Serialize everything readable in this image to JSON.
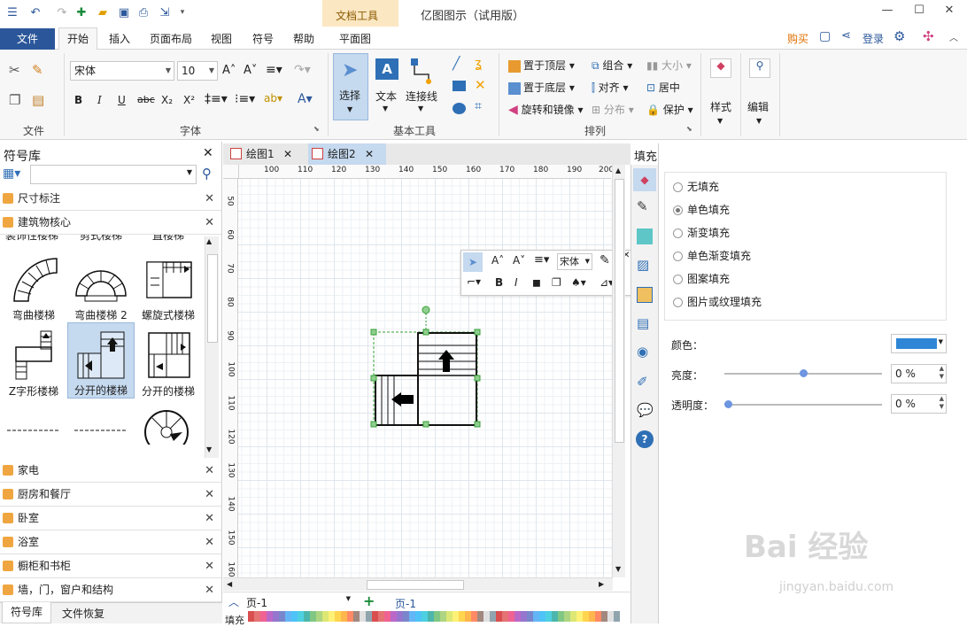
{
  "title_bar": {
    "app_title": "亿图图示（试用版）",
    "context_group": "文档工具"
  },
  "tabs": {
    "file": "文件",
    "home": "开始",
    "insert": "插入",
    "page_layout": "页面布局",
    "view": "视图",
    "symbol": "符号",
    "help": "帮助",
    "floor_plan": "平面图",
    "buy": "购买",
    "login": "登录"
  },
  "ribbon": {
    "file_group": "文件",
    "font_group": "字体",
    "basic_tools_group": "基本工具",
    "arrange_group": "排列",
    "font_name": "宋体",
    "font_size": "10",
    "select": "选择",
    "text": "文本",
    "connector": "连接线",
    "bring_to_front": "置于顶层",
    "send_to_back": "置于底层",
    "rotate_mirror": "旋转和镜像",
    "group": "组合",
    "align": "对齐",
    "distribute": "分布",
    "size": "大小",
    "center": "居中",
    "protect": "保护",
    "style": "样式",
    "edit": "编辑"
  },
  "library": {
    "title": "符号库",
    "search_placeholder": "",
    "open_categories": [
      "尺寸标注",
      "建筑物核心"
    ],
    "partial_labels": [
      "装饰性楼梯",
      "剪式楼梯",
      "直楼梯"
    ],
    "symbols": [
      {
        "label": "弯曲楼梯"
      },
      {
        "label": "弯曲楼梯 2"
      },
      {
        "label": "螺旋式楼梯"
      },
      {
        "label": "Z字形楼梯"
      },
      {
        "label": "分开的楼梯"
      },
      {
        "label": "分开的楼梯"
      }
    ],
    "closed_categories": [
      "家电",
      "厨房和餐厅",
      "卧室",
      "浴室",
      "橱柜和书柜",
      "墙，门，窗户和结构"
    ],
    "bottom_tabs": [
      "符号库",
      "文件恢复"
    ]
  },
  "documents": {
    "tabs": [
      "绘图1",
      "绘图2"
    ],
    "active": "绘图2"
  },
  "rulers": {
    "horizontal": [
      "100",
      "110",
      "120",
      "130",
      "140",
      "150",
      "160",
      "170",
      "180",
      "190",
      "200"
    ],
    "vertical": [
      "50",
      "60",
      "70",
      "80",
      "90",
      "100",
      "110",
      "120",
      "130",
      "140",
      "150",
      "160"
    ]
  },
  "float_toolbar": {
    "font": "宋体"
  },
  "page_bar": {
    "current_page": "页-1",
    "page_tab": "页-1",
    "fill_label": "填充"
  },
  "fill_panel": {
    "title": "填充",
    "options": [
      "无填充",
      "单色填充",
      "渐变填充",
      "单色渐变填充",
      "图案填充",
      "图片或纹理填充"
    ],
    "selected": "单色填充",
    "color_label": "颜色：",
    "color_value": "#2f86d6",
    "brightness_label": "亮度：",
    "brightness_value": "0 %",
    "brightness_level": 0.5,
    "transparency_label": "透明度：",
    "transparency_value": "0 %",
    "transparency_level": 0
  },
  "watermark": {
    "brand": "Bai 经验",
    "url": "jingyan.baidu.com"
  }
}
